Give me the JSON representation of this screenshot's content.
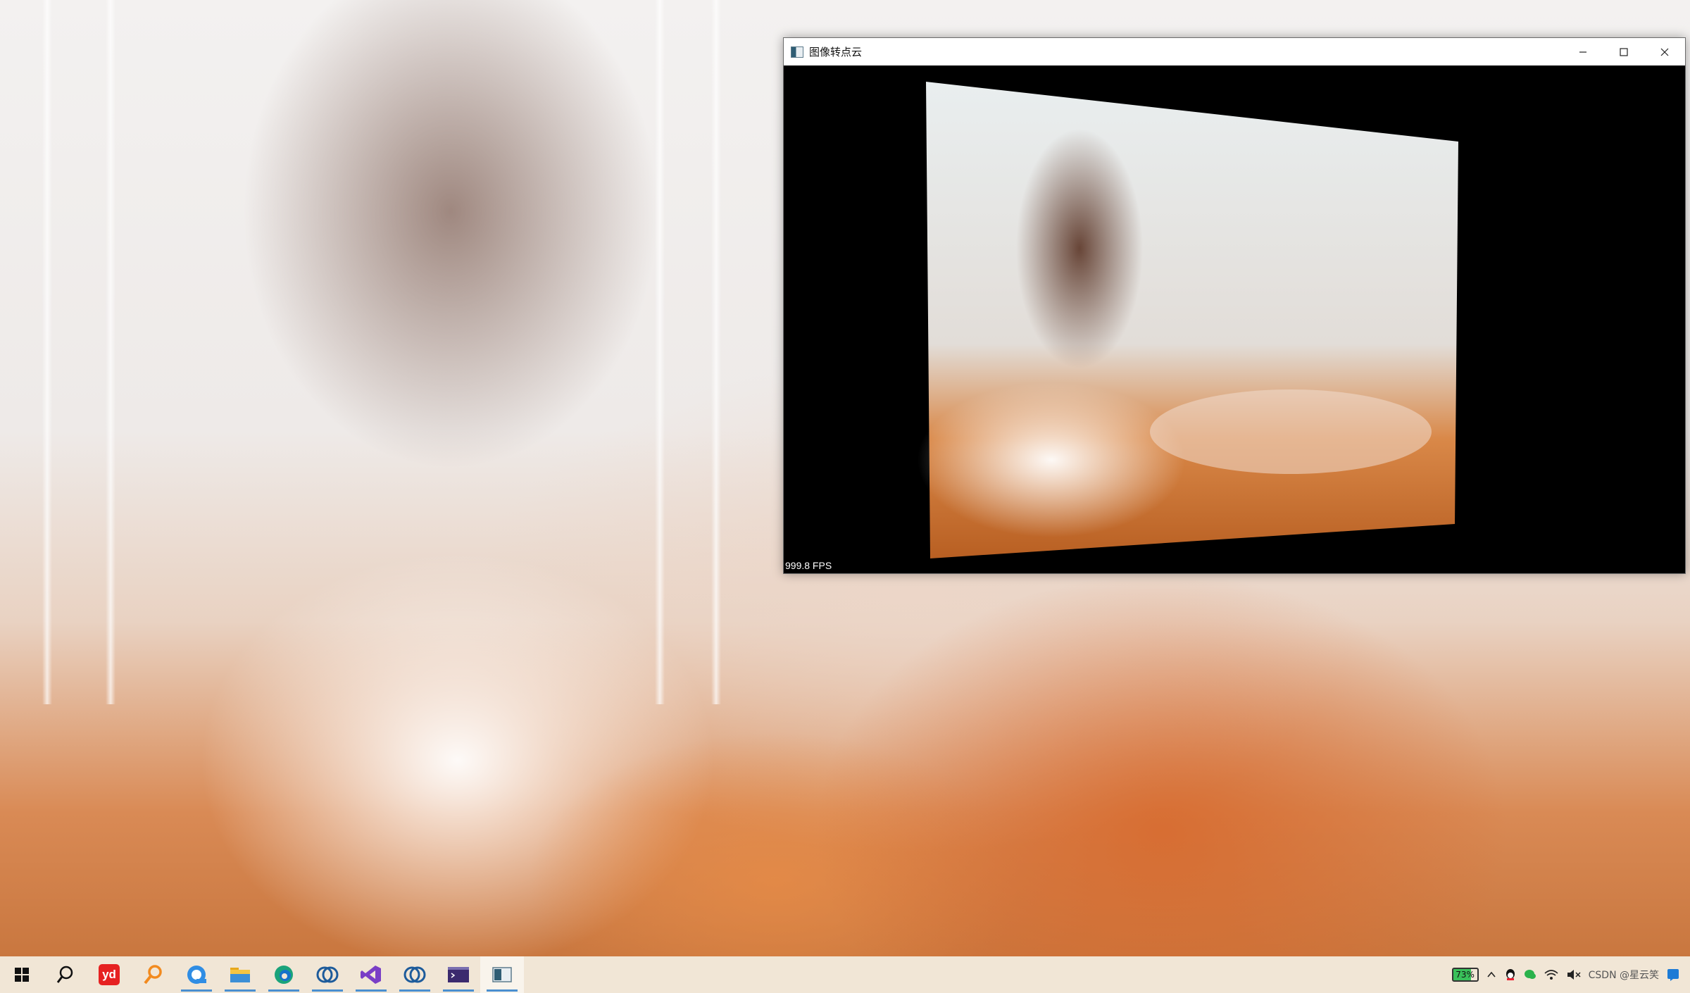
{
  "window": {
    "title": "图像转点云",
    "fps_text": "999.8 FPS"
  },
  "taskbar": {
    "items": [
      {
        "name": "start-icon",
        "active": false
      },
      {
        "name": "search-icon",
        "active": false
      },
      {
        "name": "youdao-dict-icon",
        "label": "yd",
        "active": false
      },
      {
        "name": "search-tool-icon",
        "active": false
      },
      {
        "name": "browser-icon",
        "active": false,
        "running": true
      },
      {
        "name": "file-explorer-icon",
        "active": false,
        "running": true
      },
      {
        "name": "edge-icon",
        "active": false,
        "running": true
      },
      {
        "name": "cmake-icon-1",
        "active": false,
        "running": true
      },
      {
        "name": "visual-studio-icon",
        "active": false,
        "running": true
      },
      {
        "name": "cmake-icon-2",
        "active": false,
        "running": true
      },
      {
        "name": "terminal-icon",
        "active": false,
        "running": true
      },
      {
        "name": "point-cloud-app-icon",
        "active": true,
        "running": true
      }
    ],
    "tray": {
      "battery_percent": "73%",
      "watermark": "CSDN @星云笑"
    }
  },
  "colors": {
    "taskbar_bg": "#f1e6d6",
    "running_indicator": "#4a8fd0",
    "viewport_bg": "#000000"
  }
}
